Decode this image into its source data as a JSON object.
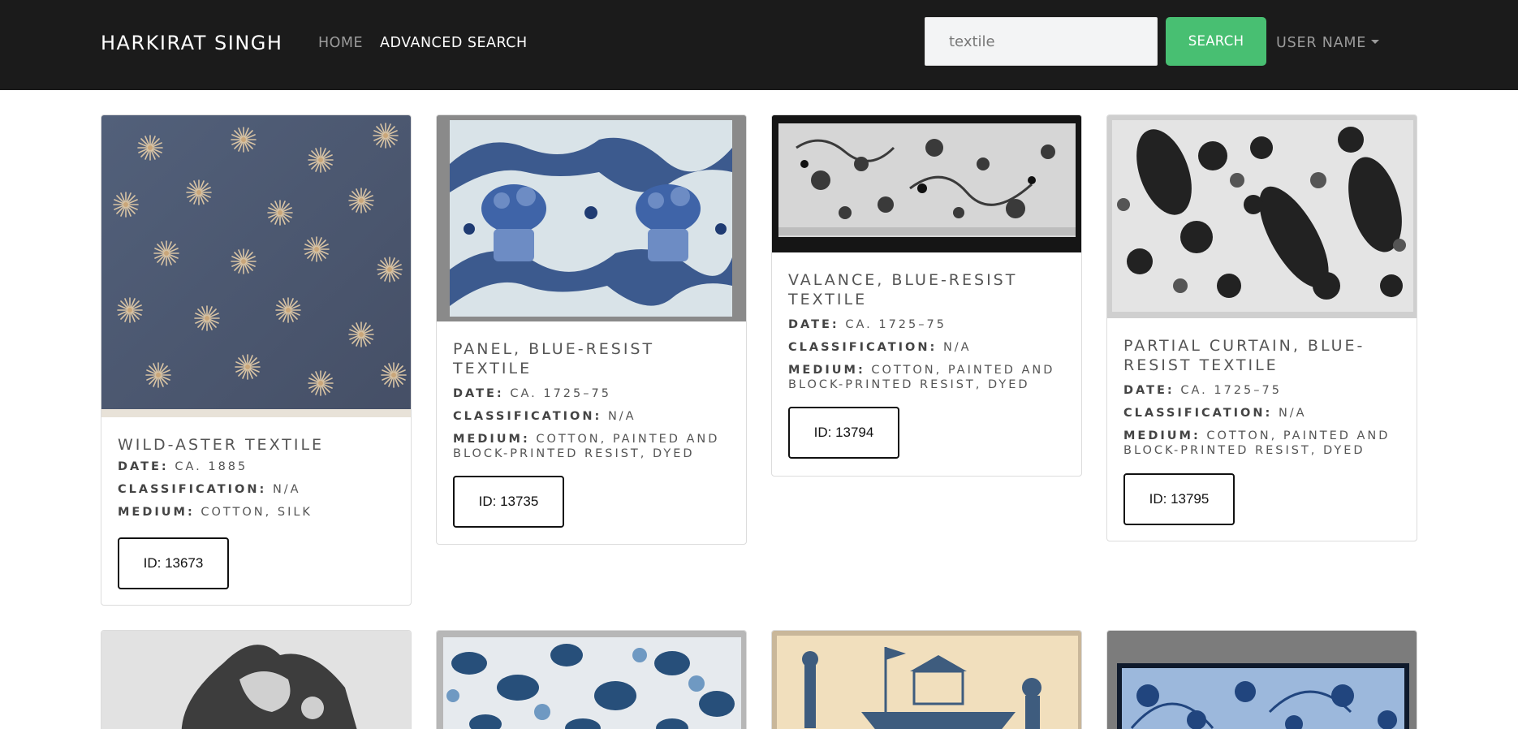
{
  "navbar": {
    "brand": "HARKIRAT SINGH",
    "home_label": "HOME",
    "advanced_search_label": "ADVANCED SEARCH",
    "search_value": "textile",
    "search_button_label": "SEARCH",
    "user_menu_label": "USER NAME"
  },
  "colors": {
    "navbar_bg": "#1b1b1b",
    "search_button": "#48bf72"
  },
  "artworks": [
    {
      "title": "WILD-ASTER TEXTILE",
      "date_label": "DATE:",
      "date": "CA. 1885",
      "classification_label": "CLASSIFICATION:",
      "classification": "N/A",
      "medium_label": "MEDIUM:",
      "medium": "COTTON, SILK",
      "id_label": "ID: 13673"
    },
    {
      "title": "PANEL, BLUE-RESIST TEXTILE",
      "date_label": "DATE:",
      "date": "CA. 1725–75",
      "classification_label": "CLASSIFICATION:",
      "classification": "N/A",
      "medium_label": "MEDIUM:",
      "medium": "COTTON, PAINTED AND BLOCK-PRINTED RESIST, DYED",
      "id_label": "ID: 13735"
    },
    {
      "title": "VALANCE, BLUE-RESIST TEXTILE",
      "date_label": "DATE:",
      "date": "CA. 1725–75",
      "classification_label": "CLASSIFICATION:",
      "classification": "N/A",
      "medium_label": "MEDIUM:",
      "medium": "COTTON, PAINTED AND BLOCK-PRINTED RESIST, DYED",
      "id_label": "ID: 13794"
    },
    {
      "title": "PARTIAL CURTAIN, BLUE-RESIST TEXTILE",
      "date_label": "DATE:",
      "date": "CA. 1725–75",
      "classification_label": "CLASSIFICATION:",
      "classification": "N/A",
      "medium_label": "MEDIUM:",
      "medium": "COTTON, PAINTED AND BLOCK-PRINTED RESIST, DYED",
      "id_label": "ID: 13795"
    }
  ]
}
